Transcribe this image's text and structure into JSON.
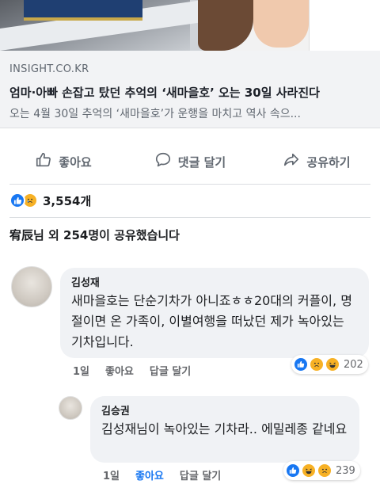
{
  "link_preview": {
    "domain": "INSIGHT.CO.KR",
    "title": "엄마·아빠 손잡고 탔던 추억의 ‘새마을호’ 오는 30일 사라진다",
    "description": "오는 4월 30일 추억의 ‘새마을호’가 운행을 마치고 역사 속으..."
  },
  "actions": {
    "like": "좋아요",
    "comment": "댓글 달기",
    "share": "공유하기"
  },
  "reactions_summary": {
    "count": "3,554개"
  },
  "shares_text": "宥辰님 외 254명이 공유했습니다",
  "comments": [
    {
      "name": "김성재",
      "text": "새마을호는 단순기차가 아니죠ㅎㅎ20대의 커플이, 명절이면 온 가족이, 이별여행을 떠났던 제가 녹아있는 기차입니다.",
      "time": "1일",
      "like_label": "좋아요",
      "reply_label": "답글 달기",
      "reaction_count": "202"
    },
    {
      "name": "김승권",
      "text": "김성재님이 녹아있는 기차라.. 에밀레종 같네요",
      "time": "1일",
      "like_label": "좋아요",
      "reply_label": "답글 달기",
      "reaction_count": "239"
    }
  ],
  "colors": {
    "facebook_blue": "#1877f2",
    "reaction_yellow": "#f7b125",
    "bubble_bg": "#f0f2f5",
    "preview_bg": "#f2f3f5"
  }
}
